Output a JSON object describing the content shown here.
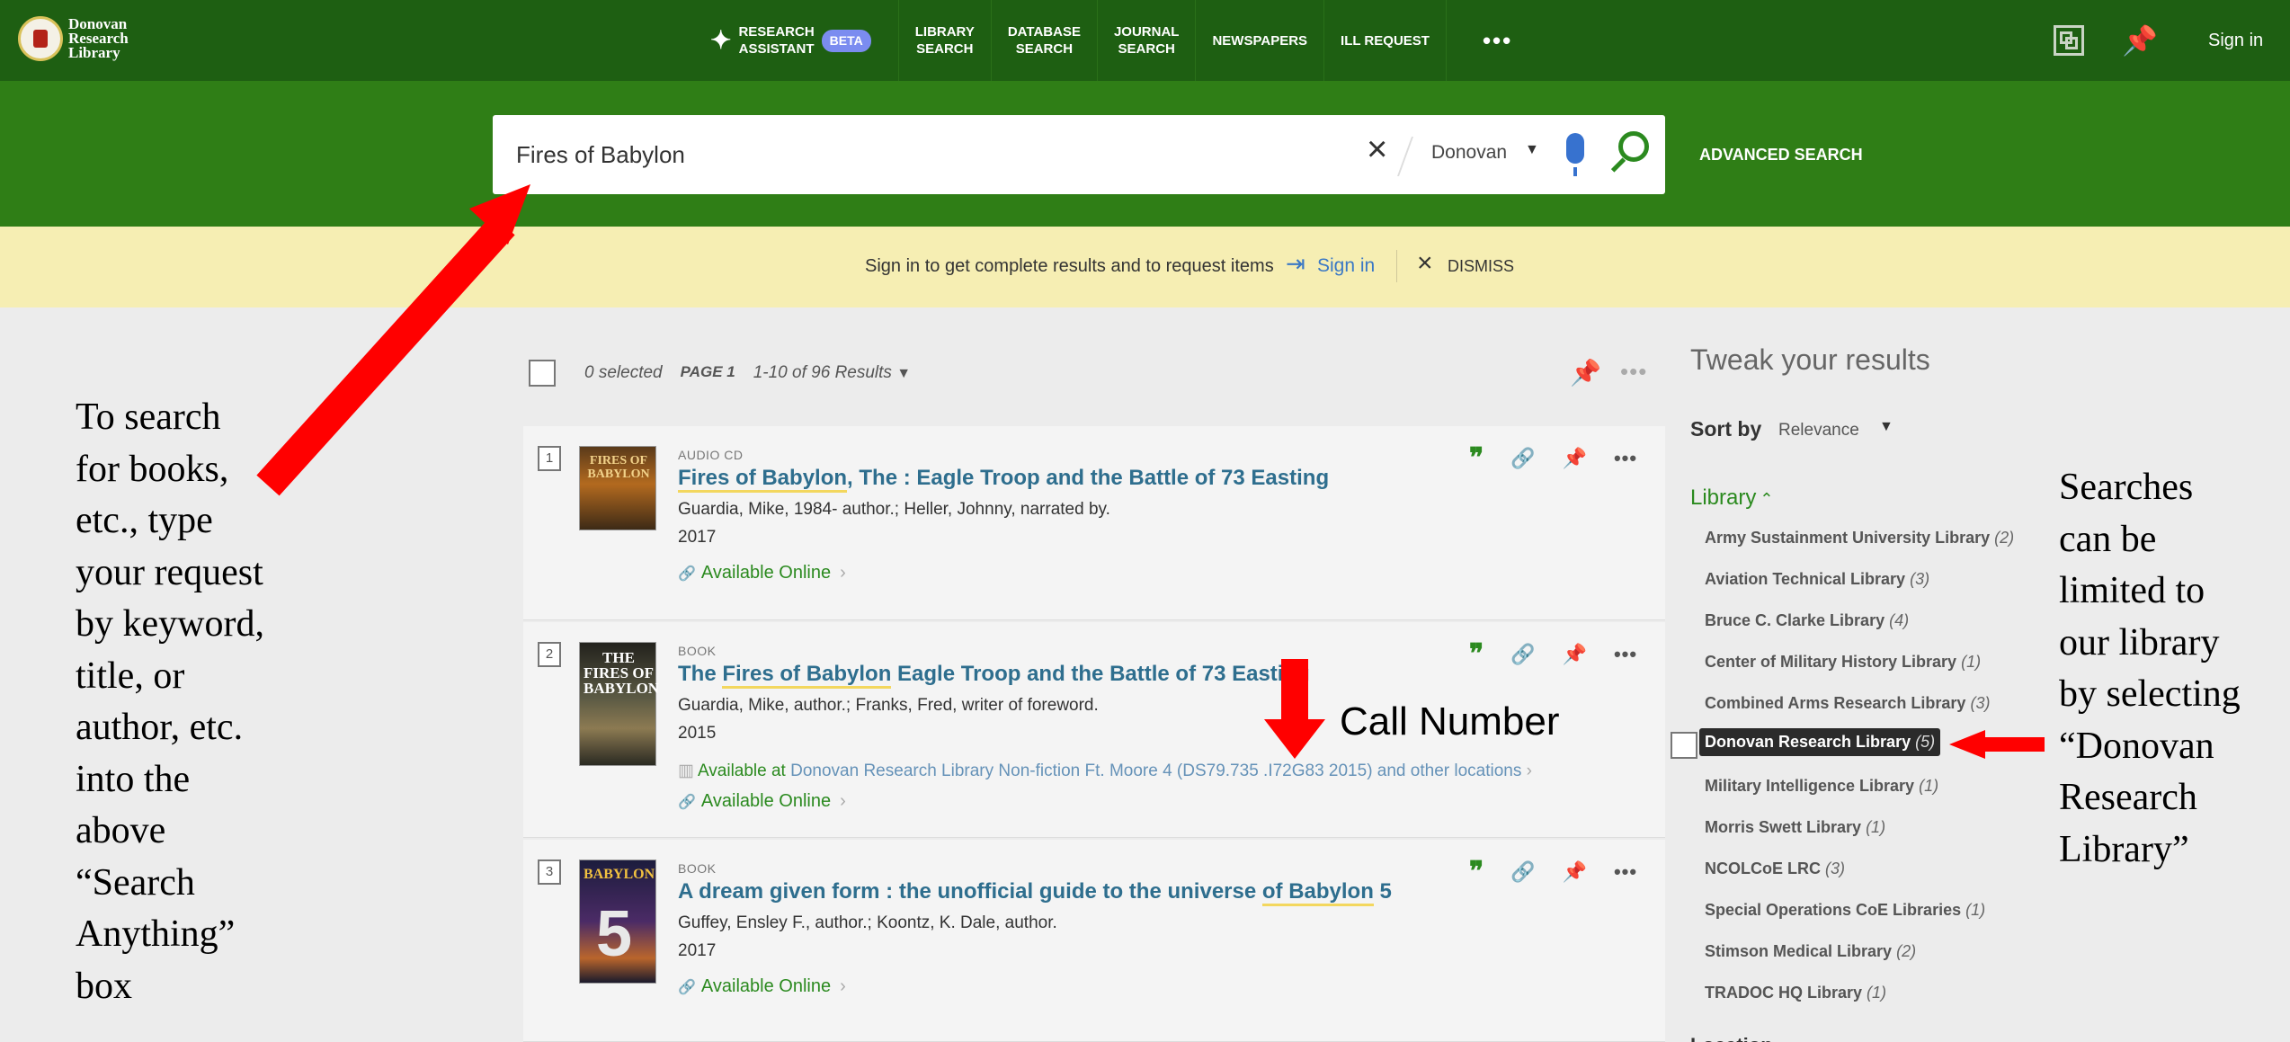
{
  "library_logo": {
    "line1": "Donovan",
    "line2": "Research",
    "line3": "Library"
  },
  "nav": {
    "research_assistant": {
      "line1": "Research",
      "line2": "Assistant",
      "badge": "BETA"
    },
    "library_search": {
      "line1": "Library",
      "line2": "Search"
    },
    "database_search": {
      "line1": "Database",
      "line2": "Search"
    },
    "journal_search": {
      "line1": "Journal",
      "line2": "Search"
    },
    "newspapers": "Newspapers",
    "ill_request": "ILL Request",
    "more": "•••",
    "sign_in": "Sign in"
  },
  "search": {
    "query": "Fires of Babylon",
    "scope": "Donovan",
    "advanced": "ADVANCED SEARCH"
  },
  "banner": {
    "message": "Sign in to get complete results and to request items",
    "sign_in": "Sign in",
    "dismiss": "DISMISS"
  },
  "results_header": {
    "selected": "0 selected",
    "page": "PAGE 1",
    "range": "1-10 of 96 Results"
  },
  "results": [
    {
      "num": "1",
      "type": "Audio CD",
      "title_pre": "",
      "title_hl": "Fires of Babylon",
      "title_post": ", The : Eagle Troop and the Battle of 73 Easting",
      "authors": "Guardia, Mike, 1984- author.; Heller, Johnny, narrated by.",
      "year": "2017",
      "online": "Available Online",
      "thumb_text": "FIRES OF BABYLON"
    },
    {
      "num": "2",
      "type": "Book",
      "title_pre": "The ",
      "title_hl": "Fires of Babylon",
      "title_post": " Eagle Troop and the Battle of 73 Easting",
      "authors": "Guardia, Mike, author.; Franks, Fred, writer of foreword.",
      "year": "2015",
      "physical_label": "Available at",
      "physical_detail": "Donovan Research Library  Non-fiction Ft. Moore 4 (DS79.735 .I72G83 2015) and other locations",
      "online": "Available Online",
      "thumb_text": "THE FIRES OF BABYLON"
    },
    {
      "num": "3",
      "type": "Book",
      "title_pre": "A dream given form : the unofficial guide to the universe ",
      "title_hl": "of Babylon",
      "title_post": " 5",
      "authors": "Guffey, Ensley F., author.; Koontz, K. Dale, author.",
      "year": "2017",
      "online": "Available Online",
      "thumb_text": "BABYLON",
      "thumb_num": "5"
    }
  ],
  "facets": {
    "tweak_title": "Tweak your results",
    "sort_label": "Sort by",
    "sort_value": "Relevance",
    "library_heading": "Library",
    "items": [
      {
        "name": "Army Sustainment University Library",
        "count": "(2)"
      },
      {
        "name": "Aviation Technical Library",
        "count": "(3)"
      },
      {
        "name": "Bruce C. Clarke Library",
        "count": "(4)"
      },
      {
        "name": "Center of Military History Library",
        "count": "(1)"
      },
      {
        "name": "Combined Arms Research Library",
        "count": "(3)"
      },
      {
        "name": "Donovan Research Library",
        "count": "(5)"
      },
      {
        "name": "Military Intelligence Library",
        "count": "(1)"
      },
      {
        "name": "Morris Swett Library",
        "count": "(1)"
      },
      {
        "name": "NCOLCoE LRC",
        "count": "(3)"
      },
      {
        "name": "Special Operations CoE Libraries",
        "count": "(1)"
      },
      {
        "name": "Stimson Medical Library",
        "count": "(2)"
      },
      {
        "name": "TRADOC HQ Library",
        "count": "(1)"
      }
    ],
    "next_heading_peek": "Location"
  },
  "annotations": {
    "left_lines": [
      "To search",
      "for books,",
      "etc., type",
      "your request",
      "by keyword,",
      "title, or",
      "author, etc.",
      "into the",
      "above",
      "“Search",
      "Anything”",
      "box"
    ],
    "right_lines": [
      "Searches",
      "can be",
      "limited to",
      "our library",
      "by selecting",
      "“Donovan",
      "Research",
      "Library”"
    ],
    "call_number": "Call Number"
  },
  "colors": {
    "nav_green": "#1e5f12",
    "search_green": "#2f7e16",
    "banner_yellow": "#f6eeb3",
    "link_blue": "#2e6e8e",
    "available_green": "#2b8a1f",
    "annotation_red": "#ff0000"
  },
  "icons": [
    "sparkle-icon",
    "qr-code-icon",
    "pin-icon",
    "clear-icon",
    "mic-icon",
    "search-icon",
    "sign-in-icon",
    "close-icon",
    "citation-icon",
    "link-icon",
    "more-icon",
    "chevron-down-icon",
    "chevron-up-icon"
  ]
}
